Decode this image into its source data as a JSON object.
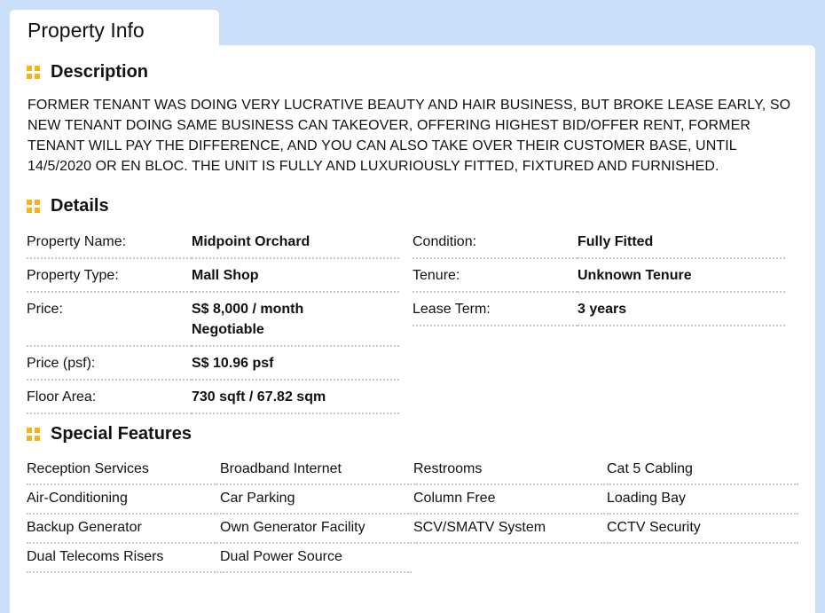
{
  "tab": {
    "title": "Property Info"
  },
  "description": {
    "heading": "Description",
    "text": "FORMER TENANT WAS DOING VERY LUCRATIVE BEAUTY AND HAIR BUSINESS, BUT BROKE LEASE EARLY, SO NEW TENANT DOING SAME BUSINESS CAN TAKEOVER, OFFERING HIGHEST BID/OFFER RENT, FORMER TENANT WILL PAY THE DIFFERENCE, AND YOU CAN ALSO TAKE OVER THEIR CUSTOMER BASE, UNTIL 14/5/2020 OR EN BLOC. THE UNIT IS FULLY AND LUXURIOUSLY FITTED, FIXTURED AND FURNISHED."
  },
  "details": {
    "heading": "Details",
    "left": [
      {
        "label": "Property Name:",
        "value": "Midpoint Orchard"
      },
      {
        "label": "Property Type:",
        "value": "Mall Shop"
      },
      {
        "label": "Price:",
        "value": "S$ 8,000 / month",
        "value2": "Negotiable"
      },
      {
        "label": "Price (psf):",
        "value": "S$ 10.96 psf"
      },
      {
        "label": "Floor Area:",
        "value": "730 sqft / 67.82 sqm"
      }
    ],
    "right": [
      {
        "label": "Condition:",
        "value": "Fully Fitted"
      },
      {
        "label": "Tenure:",
        "value": "Unknown Tenure"
      },
      {
        "label": "Lease Term:",
        "value": "3 years"
      }
    ]
  },
  "features": {
    "heading": "Special Features",
    "rows": [
      [
        "Reception Services",
        "Broadband Internet",
        "Restrooms",
        "Cat 5 Cabling"
      ],
      [
        "Air-Conditioning",
        "Car Parking",
        "Column Free",
        "Loading Bay"
      ],
      [
        "Backup Generator",
        "Own Generator Facility",
        "SCV/SMATV System",
        "CCTV Security"
      ],
      [
        "Dual Telecoms Risers",
        "Dual Power Source"
      ]
    ]
  },
  "colors": {
    "background": "#c9e0f8",
    "accent": "#f5b21a",
    "divider": "#c8c8c8"
  }
}
